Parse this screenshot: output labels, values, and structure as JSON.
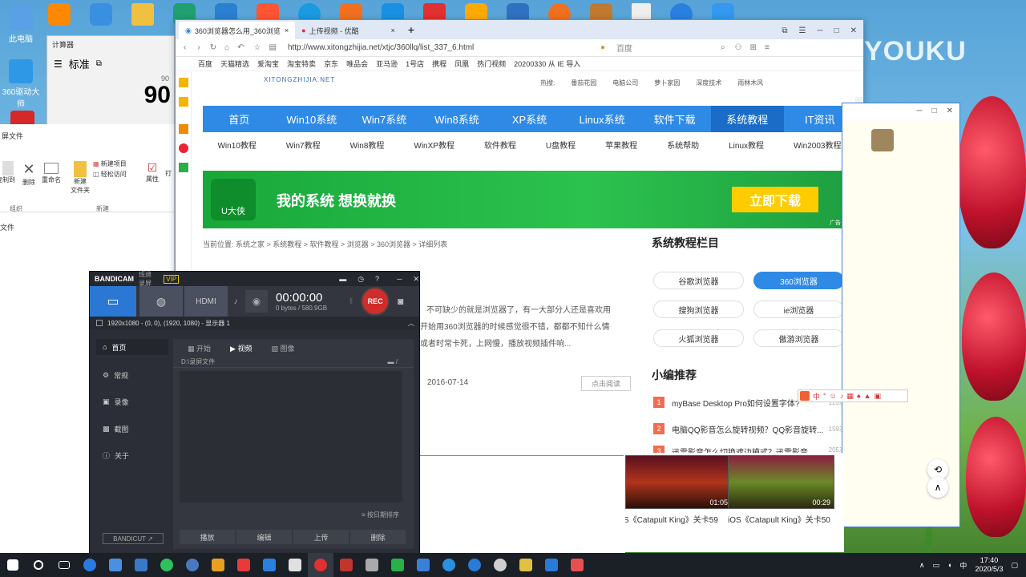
{
  "desktop": {
    "icons": [
      {
        "label": "此电脑",
        "color": "#5aa0e6"
      },
      {
        "label": "360驱动大师",
        "color": "#2e98e6"
      }
    ],
    "top_icons": [
      "#4a9ef0",
      "#ff8800",
      "#3a90e0",
      "#f0b400",
      "#20a070",
      "#2a80d0",
      "#ff5533",
      "#1a90e0",
      "#e03030",
      "#ffaa00",
      "#3070c0",
      "#f07020",
      "#c07a30",
      "#dddddd",
      "#2a80e0",
      "#3399ee"
    ]
  },
  "calculator": {
    "title": "计算器",
    "mode": "标准",
    "small_display": "90",
    "display": "90"
  },
  "explorer": {
    "title": "屏文件",
    "ribbon": {
      "copy": "复制到",
      "delete": "删除",
      "rename": "重命名",
      "new_folder": "新建\n文件夹",
      "new_item": "新建项目",
      "easy_access": "轻松访问",
      "properties": "属性",
      "open": "打",
      "group_organize": "组织",
      "group_new": "新建"
    },
    "path": "文件"
  },
  "browser": {
    "tabs": [
      {
        "label": "360浏览器怎么用_360浏览",
        "active": true
      },
      {
        "label": "上传视频 - 优酷",
        "active": false
      }
    ],
    "url": "http://www.xitongzhijia.net/xtjc/360llq/list_337_6.html",
    "search_placeholder": "百度",
    "favorites": [
      "百度",
      "天猫精选",
      "爱淘宝",
      "淘宝特卖",
      "京东",
      "唯品会",
      "亚马逊",
      "1号店",
      "携程",
      "凤凰",
      "热门视频",
      "20200330 从 IE 导入"
    ],
    "site_logo_text": "XITONGZHIJIA.NET",
    "hot_label": "热搜:",
    "hot_links": [
      "番茄花园",
      "电脑公司",
      "萝卜家园",
      "深度技术",
      "雨林木风"
    ],
    "nav": [
      "首页",
      "Win10系统",
      "Win7系统",
      "Win8系统",
      "XP系统",
      "Linux系统",
      "软件下载",
      "系统教程",
      "IT资讯"
    ],
    "subnav": [
      "Win10教程",
      "Win7教程",
      "Win8教程",
      "WinXP教程",
      "软件教程",
      "U盘教程",
      "苹果教程",
      "系统帮助",
      "Linux教程",
      "Win2003教程"
    ],
    "banner": {
      "logo": "U大侠",
      "slogan": "我的系统 想换就换",
      "cta": "立即下载",
      "ad": "广告"
    },
    "breadcrumb": "当前位置: 系统之家 > 系统教程 > 软件教程 > 浏览器 > 360浏览器 > 详细列表",
    "article": {
      "line1": "不可缺少的就是浏览器了，有一大部分人还是喜欢用",
      "line2": "开始用360浏览器的时候感觉很不错，都都不知什么情",
      "line3": "或者时常卡死，上网慢，播放视频插件响...",
      "date": "2016-07-14",
      "read_btn": "点击阅读"
    },
    "sidebar_title": "系统教程栏目",
    "sidebar_buttons": [
      {
        "label": "谷歌浏览器",
        "active": false
      },
      {
        "label": "360浏览器",
        "active": true
      },
      {
        "label": "搜狗浏览器",
        "active": false
      },
      {
        "label": "ie浏览器",
        "active": false
      },
      {
        "label": "火狐浏览器",
        "active": false
      },
      {
        "label": "傲游浏览器",
        "active": false
      }
    ],
    "recommend_title": "小编推荐",
    "recommend": [
      {
        "num": "1",
        "text": "myBase Desktop Pro如何设置字体?",
        "count": "125次"
      },
      {
        "num": "2",
        "text": "电脑QQ影音怎么旋转视频？QQ影音旋转...",
        "count": "159次"
      },
      {
        "num": "3",
        "text": "迅雷影音怎么切换遮边模式？迅雷影音...",
        "count": "205次"
      }
    ]
  },
  "ime": {
    "label": "中"
  },
  "videos": [
    {
      "title": "S《Catapult King》关卡59",
      "duration": "01:05"
    },
    {
      "title": "iOS《Catapult King》关卡50",
      "duration": "00:29"
    }
  ],
  "bandicam": {
    "brand": "BANDICAM",
    "sub": "班迪录屏",
    "vip": "VIP",
    "timer": "00:00:00",
    "size": "0 bytes / 580.9GB",
    "rec": "REC",
    "region": "1920x1080 - (0, 0), (1920, 1080) - 显示器 1",
    "sidebar": [
      {
        "label": "首页",
        "active": true
      },
      {
        "label": "常规",
        "active": false
      },
      {
        "label": "录像",
        "active": false
      },
      {
        "label": "截图",
        "active": false
      },
      {
        "label": "关于",
        "active": false
      }
    ],
    "tabs": [
      "开始",
      "视频",
      "图像"
    ],
    "path": "D:\\录屏文件",
    "sort": "按日期排序",
    "actions": [
      "播放",
      "编辑",
      "上传",
      "删除"
    ],
    "bandicut": "BANDICUT ↗"
  },
  "youku_watermark": "YOUKU",
  "taskbar": {
    "time": "17:40",
    "date": "2020/5/3",
    "apps": [
      "#2a7ae2",
      "#4a90e2",
      "#3a78c8",
      "#2ec05c",
      "#4a78c0",
      "#e8a020",
      "#e83a3a",
      "#2a80e0",
      "#e0e0e0",
      "#e03030",
      "#c0362c",
      "#aaaaaa",
      "#2ab04a",
      "#3a80d8",
      "#2a90e0",
      "#d0d0d0",
      "#2a7ad8",
      "#e85050"
    ]
  }
}
